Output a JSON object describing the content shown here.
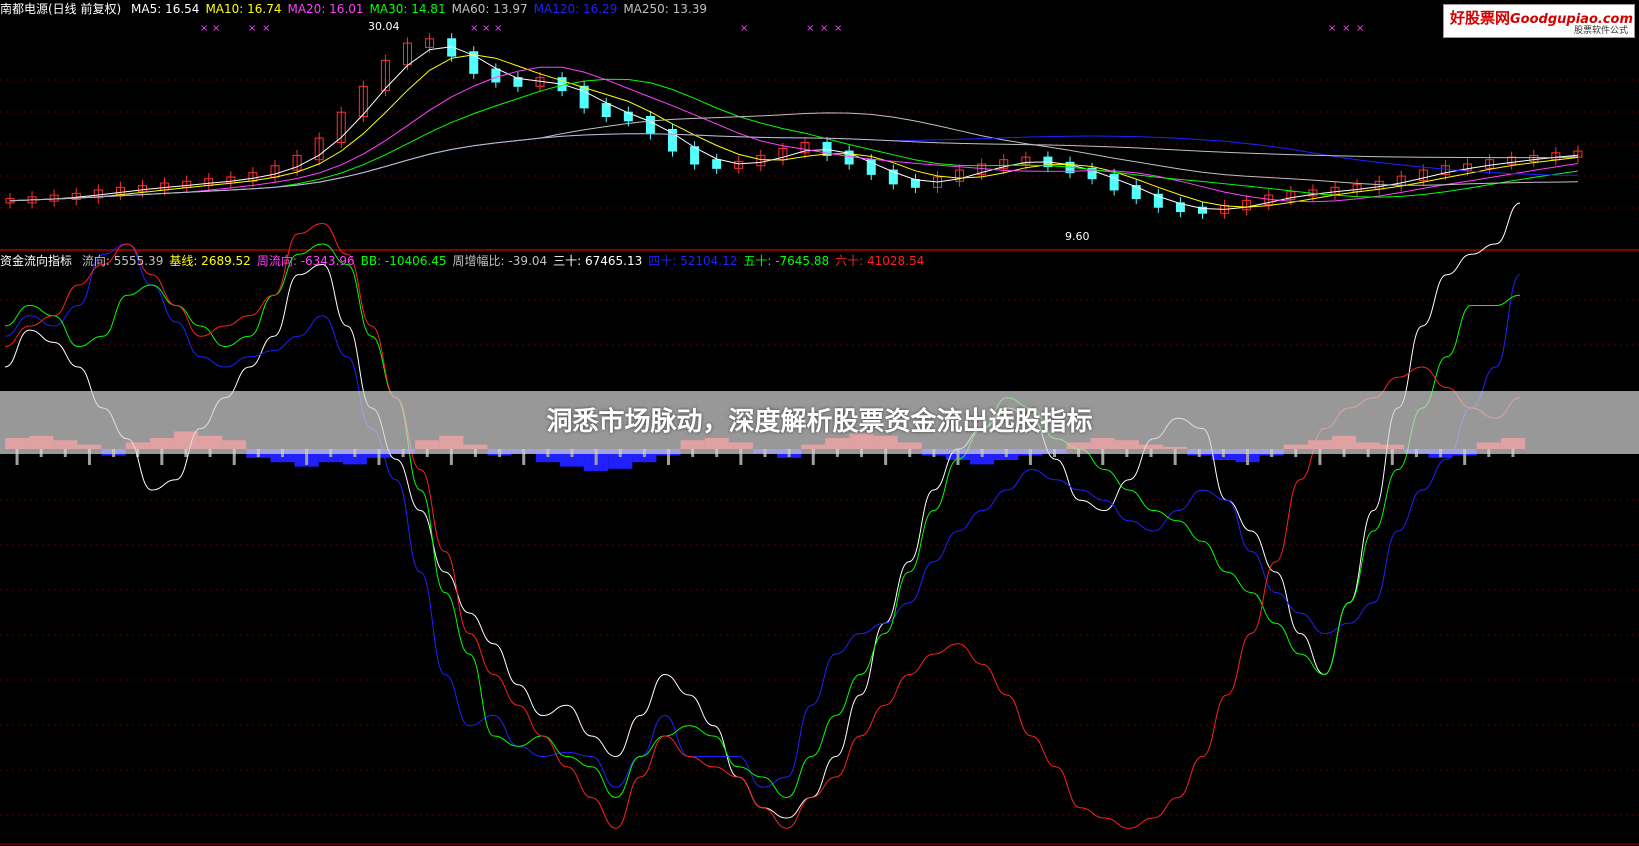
{
  "main_panel": {
    "stock_name": "南都电源(日线 前复权)",
    "ma_labels": [
      {
        "text": "MA5: 16.54",
        "color": "#ffffff"
      },
      {
        "text": "MA10: 16.74",
        "color": "#ffff00"
      },
      {
        "text": "MA20: 16.01",
        "color": "#ff40ff"
      },
      {
        "text": "MA30: 14.81",
        "color": "#00ff00"
      },
      {
        "text": "MA60: 13.97",
        "color": "#c0c0c0"
      },
      {
        "text": "MA120: 16.29",
        "color": "#2020ff"
      },
      {
        "text": "MA250: 13.39",
        "color": "#c0c0c0"
      }
    ],
    "high_marker": "30.04",
    "low_marker": "9.60"
  },
  "indicator_panel": {
    "name": "资金流向指标",
    "labels": [
      {
        "text": "流向: 5555.39",
        "color": "#c0c0c0"
      },
      {
        "text": "基线: 2689.52",
        "color": "#ffff00"
      },
      {
        "text": "周流向: -6343.96",
        "color": "#ff40ff"
      },
      {
        "text": "BB: -10406.45",
        "color": "#00ff00"
      },
      {
        "text": "周增幅比: -39.04",
        "color": "#c0c0c0"
      },
      {
        "text": "三十: 67465.13",
        "color": "#ffffff"
      },
      {
        "text": "四十: 52104.12",
        "color": "#2020ff"
      },
      {
        "text": "五十: -7645.88",
        "color": "#00ff00"
      },
      {
        "text": "六十: 41028.54",
        "color": "#ff2020"
      }
    ]
  },
  "logo": {
    "brand": "好股票网",
    "domain": "Goodgupiao.com",
    "tagline": "股票软件公式"
  },
  "banner": {
    "title": "洞悉市场脉动，深度解析股票资金流出选股指标"
  },
  "chart_data": [
    {
      "type": "candlestick",
      "title": "南都电源(日线 前复权)",
      "annotations": [
        "30.04",
        "9.60"
      ],
      "series": [
        {
          "name": "MA5",
          "color": "#ffffff"
        },
        {
          "name": "MA10",
          "color": "#ffff00"
        },
        {
          "name": "MA20",
          "color": "#ff40ff"
        },
        {
          "name": "MA30",
          "color": "#00ff00"
        },
        {
          "name": "MA60",
          "color": "#c0c0c0"
        },
        {
          "name": "MA120",
          "color": "#2020ff"
        },
        {
          "name": "MA250",
          "color": "#c0c0c0"
        }
      ],
      "close_path": [
        11,
        11.2,
        11.4,
        11.6,
        12,
        12.3,
        12.5,
        12.8,
        13,
        13.3,
        13.5,
        14,
        14.8,
        16,
        18,
        21,
        24,
        27,
        29,
        29.5,
        28,
        26,
        25,
        24.5,
        25,
        24,
        22,
        21,
        20.5,
        19,
        17,
        15.5,
        15,
        15.3,
        16,
        16.8,
        17.5,
        16.5,
        15.5,
        14.3,
        13.2,
        12.8,
        13.5,
        14.3,
        15,
        15.5,
        15.8,
        15.2,
        14.5,
        13.8,
        12.5,
        11.5,
        10.5,
        10,
        9.8,
        10.2,
        10.8,
        11.4,
        11.8,
        12,
        12.3,
        12.6,
        13,
        13.6,
        14.3,
        14.8,
        15,
        15.5,
        15.8,
        16,
        16.3,
        16.5
      ]
    },
    {
      "type": "line",
      "title": "资金流向指标",
      "series": [
        {
          "name": "三十",
          "color": "#ffffff",
          "values": [
            40,
            58,
            52,
            40,
            20,
            5,
            -20,
            -15,
            10,
            25,
            40,
            55,
            85,
            90,
            60,
            20,
            -5,
            -30,
            -60,
            -80,
            -95,
            -115,
            -130,
            -125,
            -140,
            -150,
            -130,
            -110,
            -120,
            -135,
            -160,
            -175,
            -180,
            -170,
            -150,
            -120,
            -85,
            -55,
            -20,
            0,
            10,
            20,
            15,
            -5,
            -25,
            -30,
            -15,
            5,
            15,
            10,
            -25,
            -40,
            -60,
            -90,
            -110,
            -75,
            -30,
            20,
            60,
            85,
            95,
            100,
            120
          ]
        },
        {
          "name": "四十",
          "color": "#2020ff",
          "values": [
            55,
            65,
            60,
            70,
            95,
            100,
            80,
            62,
            45,
            40,
            45,
            48,
            55,
            65,
            45,
            10,
            -15,
            -60,
            -110,
            -135,
            -130,
            -145,
            -150,
            -148,
            -150,
            -165,
            -150,
            -130,
            -150,
            -150,
            -150,
            -165,
            -160,
            -125,
            -100,
            -90,
            -85,
            -75,
            -55,
            -40,
            -30,
            -20,
            -10,
            -15,
            -20,
            -25,
            -35,
            -40,
            -30,
            -20,
            -25,
            -50,
            -70,
            -80,
            -90,
            -85,
            -75,
            -40,
            -20,
            -5,
            20,
            40,
            85
          ]
        },
        {
          "name": "五十",
          "color": "#00ff00",
          "values": [
            60,
            70,
            65,
            50,
            55,
            75,
            80,
            70,
            60,
            50,
            55,
            75,
            95,
            100,
            90,
            55,
            25,
            -20,
            -70,
            -100,
            -140,
            -145,
            -140,
            -150,
            -155,
            -170,
            -150,
            -140,
            -135,
            -140,
            -155,
            -160,
            -170,
            -150,
            -130,
            -110,
            -90,
            -60,
            -30,
            -5,
            10,
            25,
            20,
            5,
            0,
            -10,
            -20,
            -30,
            -35,
            -45,
            -60,
            -70,
            -85,
            -100,
            -110,
            -75,
            -40,
            -10,
            20,
            45,
            70,
            70,
            75
          ]
        },
        {
          "name": "六十",
          "color": "#ff2020",
          "values": [
            50,
            60,
            65,
            80,
            90,
            100,
            85,
            70,
            55,
            60,
            65,
            75,
            105,
            110,
            95,
            60,
            25,
            -10,
            -50,
            -90,
            -110,
            -125,
            -140,
            -155,
            -170,
            -185,
            -160,
            -140,
            -150,
            -155,
            -160,
            -175,
            -185,
            -170,
            -160,
            -140,
            -125,
            -110,
            -100,
            -95,
            -105,
            -120,
            -140,
            -155,
            -175,
            -180,
            -185,
            -180,
            -170,
            -150,
            -120,
            -90,
            -55,
            -15,
            10,
            20,
            25,
            35,
            40,
            30,
            20,
            15,
            25
          ]
        }
      ],
      "histogram": [
        5,
        6,
        4,
        2,
        -3,
        3,
        5,
        8,
        6,
        4,
        -4,
        -6,
        -8,
        -6,
        -7,
        -4,
        -2,
        4,
        6,
        2,
        -3,
        -2,
        -6,
        -8,
        -10,
        -9,
        -6,
        -3,
        4,
        5,
        3,
        -2,
        -4,
        2,
        5,
        7,
        6,
        3,
        -3,
        -5,
        -7,
        -5,
        -3,
        -2,
        3,
        5,
        4,
        2,
        1,
        -3,
        -5,
        -6,
        -3,
        2,
        4,
        6,
        3,
        2,
        -2,
        -4,
        -3,
        3,
        5
      ]
    }
  ]
}
